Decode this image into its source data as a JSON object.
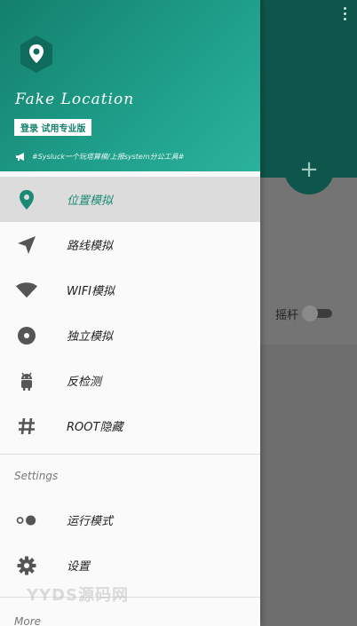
{
  "app": {
    "title": "Fake Location",
    "login_label": "登录 试用专业版",
    "notice": "#Sysluck一个玩塔算模/上报system分公工具#"
  },
  "menu": {
    "items": [
      {
        "label": "位置模拟",
        "icon": "location-pin-icon",
        "active": true
      },
      {
        "label": "路线模拟",
        "icon": "navigation-arrow-icon",
        "active": false
      },
      {
        "label": "WIFI模拟",
        "icon": "wifi-icon",
        "active": false
      },
      {
        "label": "独立模拟",
        "icon": "disc-icon",
        "active": false
      },
      {
        "label": "反检测",
        "icon": "android-icon",
        "active": false
      },
      {
        "label": "ROOT隐藏",
        "icon": "hash-icon",
        "active": false
      }
    ]
  },
  "settings": {
    "section_title": "Settings",
    "items": [
      {
        "label": "运行模式",
        "icon": "toggle-icon"
      },
      {
        "label": "设置",
        "icon": "gear-icon"
      }
    ]
  },
  "more": {
    "section_title": "More"
  },
  "background": {
    "rocker_label": "摇杆",
    "fab_symbol": "+",
    "rocker_enabled": false
  },
  "watermark": "YYDS源码网",
  "colors": {
    "accent": "#1a8a75",
    "header_start": "#13806d",
    "header_end": "#2bb29c",
    "dark_teal": "#0e564b"
  }
}
